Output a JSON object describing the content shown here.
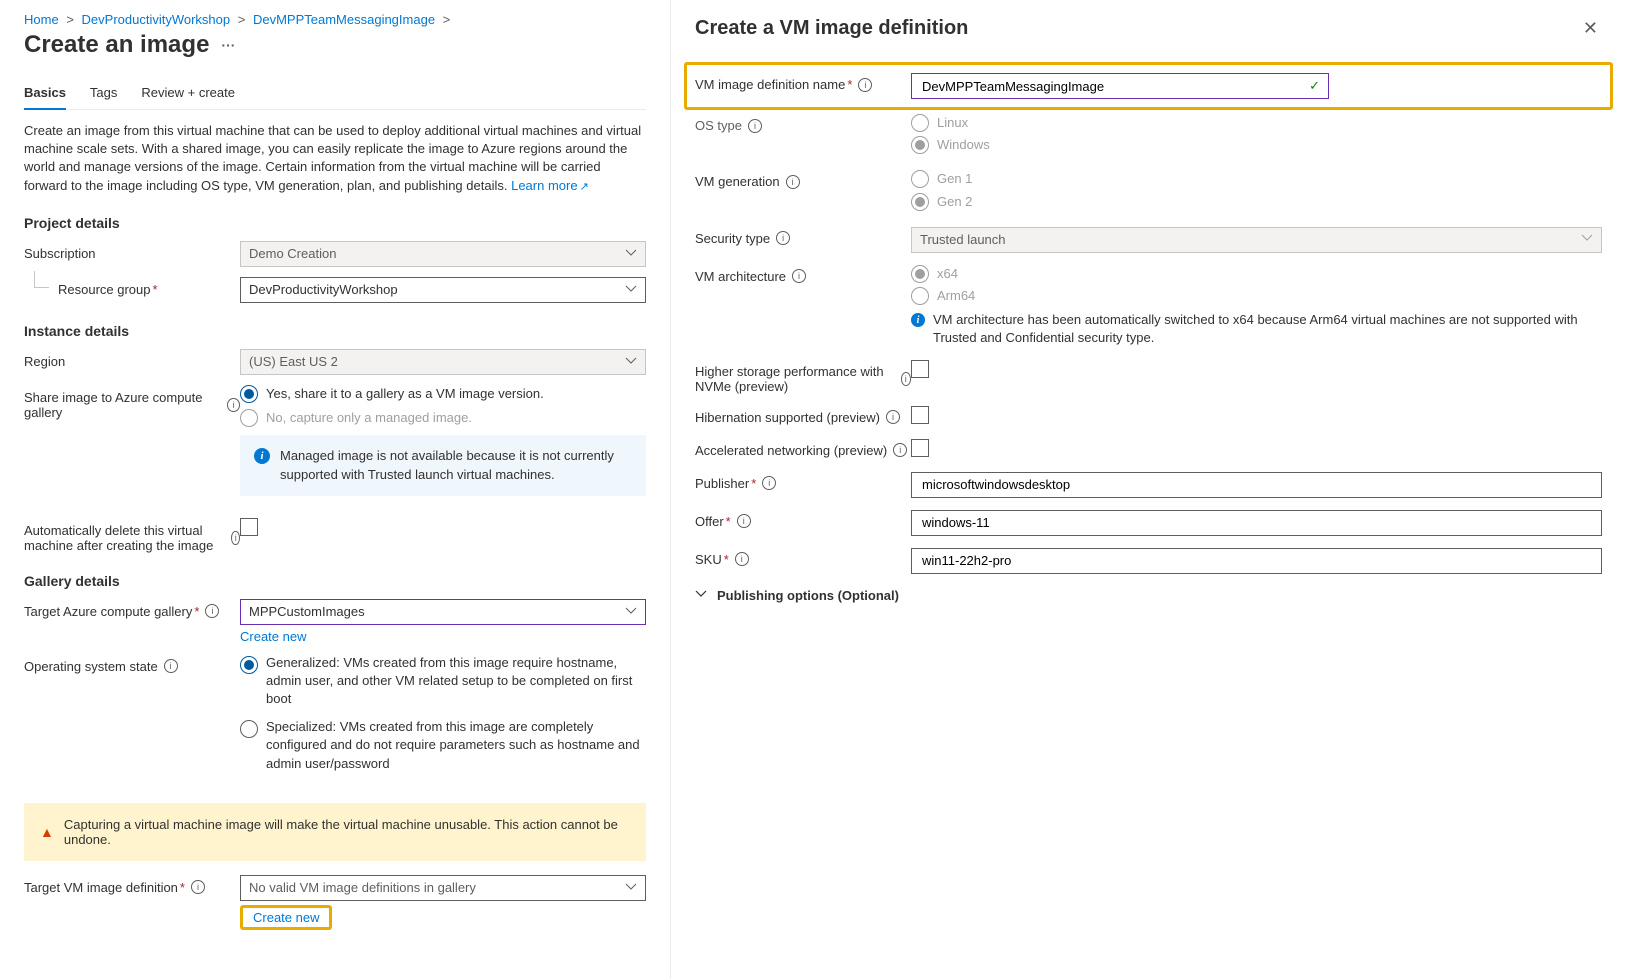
{
  "breadcrumb": {
    "items": [
      "Home",
      "DevProductivityWorkshop",
      "DevMPPTeamMessagingImage"
    ]
  },
  "page": {
    "title": "Create an image",
    "intro": "Create an image from this virtual machine that can be used to deploy additional virtual machines and virtual machine scale sets. With a shared image, you can easily replicate the image to Azure regions around the world and manage versions of the image. Certain information from the virtual machine will be carried forward to the image including OS type, VM generation, plan, and publishing details.",
    "learn_more": "Learn more"
  },
  "tabs": [
    "Basics",
    "Tags",
    "Review + create"
  ],
  "sections": {
    "project": "Project details",
    "instance": "Instance details",
    "gallery": "Gallery details"
  },
  "labels": {
    "subscription": "Subscription",
    "resource_group": "Resource group",
    "region": "Region",
    "share": "Share image to Azure compute gallery",
    "auto_delete": "Automatically delete this virtual machine after creating the image",
    "target_gallery": "Target Azure compute gallery",
    "os_state": "Operating system state",
    "target_def": "Target VM image definition",
    "create_new": "Create new"
  },
  "values": {
    "subscription": "Demo Creation",
    "resource_group": "DevProductivityWorkshop",
    "region": "(US) East US 2",
    "target_gallery": "MPPCustomImages",
    "target_def": "No valid VM image definitions in gallery"
  },
  "share_options": {
    "yes": "Yes, share it to a gallery as a VM image version.",
    "no": "No, capture only a managed image."
  },
  "managed_callout": "Managed image is not available because it is not currently supported with Trusted launch virtual machines.",
  "os_state_options": {
    "generalized": "Generalized: VMs created from this image require hostname, admin user, and other VM related setup to be completed on first boot",
    "specialized": "Specialized: VMs created from this image are completely configured and do not require parameters such as hostname and admin user/password"
  },
  "warning": "Capturing a virtual machine image will make the virtual machine unusable. This action cannot be undone.",
  "right": {
    "title": "Create a VM image definition",
    "labels": {
      "name": "VM image definition name",
      "os_type": "OS type",
      "vm_gen": "VM generation",
      "sec_type": "Security type",
      "vm_arch": "VM architecture",
      "nvme": "Higher storage performance with NVMe (preview)",
      "hibernation": "Hibernation supported (preview)",
      "accel_net": "Accelerated networking (preview)",
      "publisher": "Publisher",
      "offer": "Offer",
      "sku": "SKU",
      "publishing": "Publishing options (Optional)"
    },
    "values": {
      "name": "DevMPPTeamMessagingImage",
      "sec_type": "Trusted launch",
      "publisher": "microsoftwindowsdesktop",
      "offer": "windows-11",
      "sku": "win11-22h2-pro"
    },
    "os_options": {
      "linux": "Linux",
      "windows": "Windows"
    },
    "gen_options": {
      "gen1": "Gen 1",
      "gen2": "Gen 2"
    },
    "arch_options": {
      "x64": "x64",
      "arm64": "Arm64"
    },
    "arch_info": "VM architecture has been automatically switched to x64 because Arm64 virtual machines are not supported with Trusted and Confidential security type."
  }
}
